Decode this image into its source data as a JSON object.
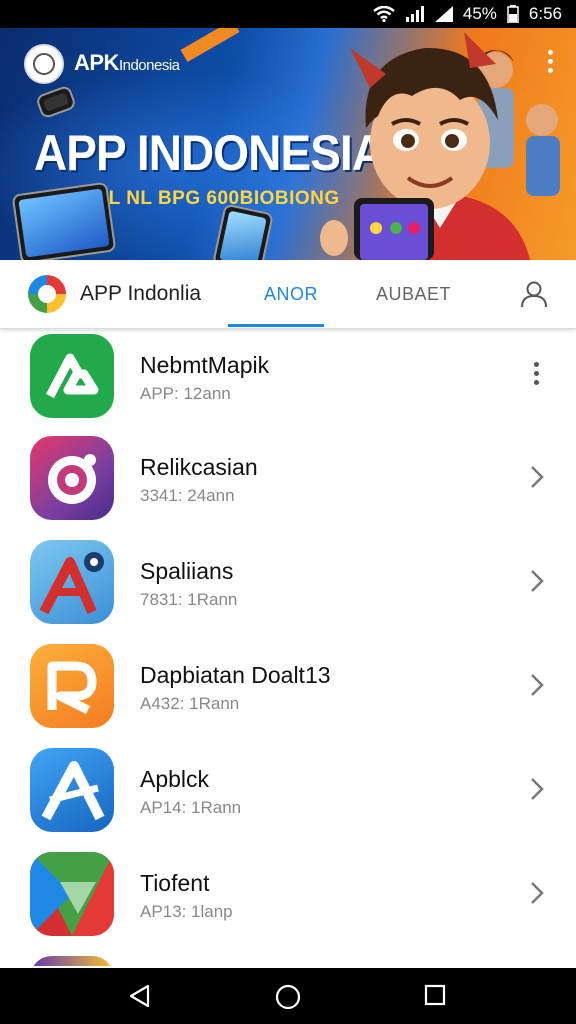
{
  "status_bar": {
    "battery": "45%",
    "time": "6:56"
  },
  "banner": {
    "brand": "APK",
    "brand_suffix": "Indonesia",
    "headline": "APP INDONESIA",
    "tagline": "7AFE L NL BPG 600BIOBIONG"
  },
  "tabs": {
    "app_name": "APP Indonlia",
    "items": [
      {
        "label": "ANOR",
        "active": true
      },
      {
        "label": "AUBAET",
        "active": false
      }
    ]
  },
  "apps": [
    {
      "title": "NebmtMapik",
      "subtitle": "APP: 12ann",
      "action": "more",
      "icon": "green-arrow-icon",
      "color": "#21a94a"
    },
    {
      "title": "Relikcasian",
      "subtitle": "3341: 24ann",
      "action": "chevron",
      "icon": "target-icon",
      "color": "#7b3fa0"
    },
    {
      "title": "Spaliians",
      "subtitle": "7831: 1Rann",
      "action": "chevron",
      "icon": "map-pin-a-icon",
      "color": "#4aa3df"
    },
    {
      "title": "Dapbiatan Doalt13",
      "subtitle": "A432: 1Rann",
      "action": "chevron",
      "icon": "r-logo-icon",
      "color": "#f57c1f"
    },
    {
      "title": "Apblck",
      "subtitle": "AP14: 1Rann",
      "action": "chevron",
      "icon": "blue-a-icon",
      "color": "#1e88e5"
    },
    {
      "title": "Tiofent",
      "subtitle": "AP13: 1lanp",
      "action": "chevron",
      "icon": "play-triangle-icon",
      "color": "#2e7d32"
    }
  ]
}
